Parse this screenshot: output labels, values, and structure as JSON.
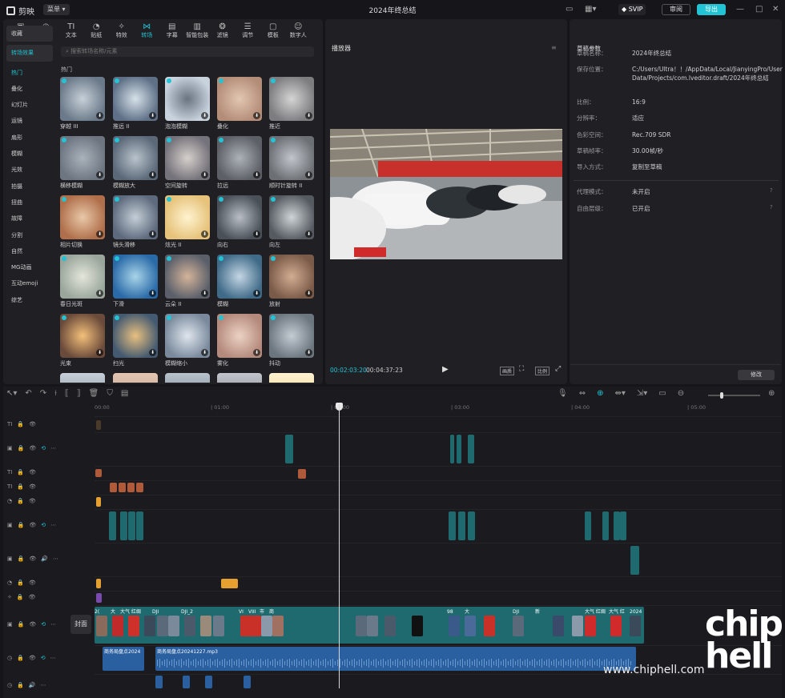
{
  "titlebar": {
    "app_name": "剪映",
    "menu_label": "菜单",
    "window_title": "2024年终总结",
    "svip_label": "SVIP",
    "review_label": "审阅",
    "export_label": "导出",
    "minimize_icon": "—",
    "maximize_icon": "□",
    "close_icon": "✕"
  },
  "media_tabs": [
    {
      "label": "素材",
      "icon": "▣"
    },
    {
      "label": "音频",
      "icon": "◷"
    },
    {
      "label": "文本",
      "icon": "TI"
    },
    {
      "label": "贴纸",
      "icon": "◔"
    },
    {
      "label": "特效",
      "icon": "✧"
    },
    {
      "label": "转场",
      "icon": "⋈"
    },
    {
      "label": "字幕",
      "icon": "▤"
    },
    {
      "label": "智能包装",
      "icon": "▥"
    },
    {
      "label": "滤镜",
      "icon": "❂"
    },
    {
      "label": "调节",
      "icon": "☰"
    },
    {
      "label": "模板",
      "icon": "▢"
    },
    {
      "label": "数字人",
      "icon": "☺"
    }
  ],
  "active_tab": 5,
  "sidebar": {
    "favorites": "收藏",
    "group": "转场效果",
    "items": [
      "热门",
      "叠化",
      "幻灯片",
      "运镜",
      "扇形",
      "模糊",
      "光效",
      "拍摄",
      "扭曲",
      "故障",
      "分割",
      "自然",
      "MG动画",
      "互动emoji",
      "综艺"
    ]
  },
  "search": {
    "placeholder": "搜索转场名称/元素"
  },
  "section_title": "热门",
  "transitions": [
    [
      "穿越 III",
      "推远 II",
      "泡泡模糊",
      "叠化",
      "推近"
    ],
    [
      "横移模糊",
      "模糊放大",
      "空间旋转",
      "拉远",
      "顺时针旋转 II"
    ],
    [
      "相片切换",
      "镜头滑移",
      "炫光 II",
      "向右",
      "向左"
    ],
    [
      "春日光斑",
      "下滑",
      "云朵 II",
      "模糊",
      "放射"
    ],
    [
      "光束",
      "扫光",
      "模糊缩小",
      "雾化",
      "抖动"
    ]
  ],
  "player": {
    "title": "播放器",
    "current_time": "00:02:03:20",
    "total_time": "00:04:37:23",
    "quality_label": "画质",
    "ratio_label": "比例"
  },
  "draft": {
    "title": "草稿参数",
    "fields": [
      {
        "label": "草稿名称：",
        "value": "2024年终总结"
      },
      {
        "label": "保存位置：",
        "value": "C:/Users/Ultra！！/AppData/Local/JianyingPro/User Data/Projects/com.lveditor.draft/2024年终总结"
      },
      {
        "label": "比例：",
        "value": "16:9"
      },
      {
        "label": "分辨率：",
        "value": "适应"
      },
      {
        "label": "色彩空间：",
        "value": "Rec.709 SDR"
      },
      {
        "label": "草稿帧率：",
        "value": "30.00帧/秒"
      },
      {
        "label": "导入方式：",
        "value": "复制至草稿"
      },
      {
        "label": "代理模式：",
        "value": "未开启"
      },
      {
        "label": "自由层级：",
        "value": "已开启"
      }
    ],
    "modify_label": "修改"
  },
  "timeline": {
    "ruler": [
      "00:00",
      "| 01:00",
      "| 02:00",
      "| 03:00",
      "| 04:00",
      "| 05:00"
    ],
    "cover_label": "封面",
    "audio_clips": [
      "商务局盘点2024",
      "商务局盘点20241227.mp3"
    ],
    "main_clip_titles": [
      "2(",
      "大",
      "大气 红绸",
      "DJI",
      "DJI_2",
      "VI",
      "VIII",
      "市",
      "商",
      "98",
      "大",
      "DJI",
      "新",
      "大气 红绸",
      "大气 红",
      "2024"
    ]
  },
  "colors": {
    "accent": "#22c3d4",
    "panel": "#202024",
    "clip_teal": "#1e6a6e",
    "audio": "#2a5fa0"
  },
  "watermark": {
    "site": "www.chiphell.com",
    "logo": "chip hell"
  }
}
